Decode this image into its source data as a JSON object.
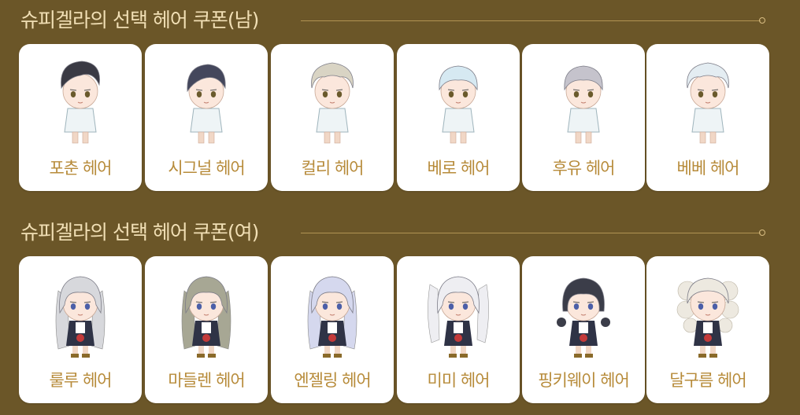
{
  "sections": [
    {
      "title": "슈피겔라의 선택 헤어 쿠폰(남)",
      "items": [
        {
          "label": "포춘 헤어",
          "hair": "#3a3a44",
          "style": "male-swept"
        },
        {
          "label": "시그널 헤어",
          "hair": "#44475c",
          "style": "male-side"
        },
        {
          "label": "컬리 헤어",
          "hair": "#d9d4c4",
          "style": "male-curly"
        },
        {
          "label": "베로 헤어",
          "hair": "#d6e9f2",
          "style": "male-bowl"
        },
        {
          "label": "후유 헤어",
          "hair": "#c5c3cc",
          "style": "male-bowl"
        },
        {
          "label": "베베 헤어",
          "hair": "#e4edf2",
          "style": "male-curly"
        }
      ]
    },
    {
      "title": "슈피겔라의 선택 헤어 쿠폰(여)",
      "items": [
        {
          "label": "룰루 헤어",
          "hair": "#d7d8dc",
          "style": "female-wavy"
        },
        {
          "label": "마들렌 헤어",
          "hair": "#a7a794",
          "style": "female-long"
        },
        {
          "label": "엔젤링 헤어",
          "hair": "#d5d8ee",
          "style": "female-long"
        },
        {
          "label": "미미 헤어",
          "hair": "#eeeef2",
          "style": "female-twin"
        },
        {
          "label": "핑키웨이 헤어",
          "hair": "#3b3d49",
          "style": "female-short"
        },
        {
          "label": "달구름 헤어",
          "hair": "#ede9e0",
          "style": "female-curly"
        }
      ]
    }
  ]
}
